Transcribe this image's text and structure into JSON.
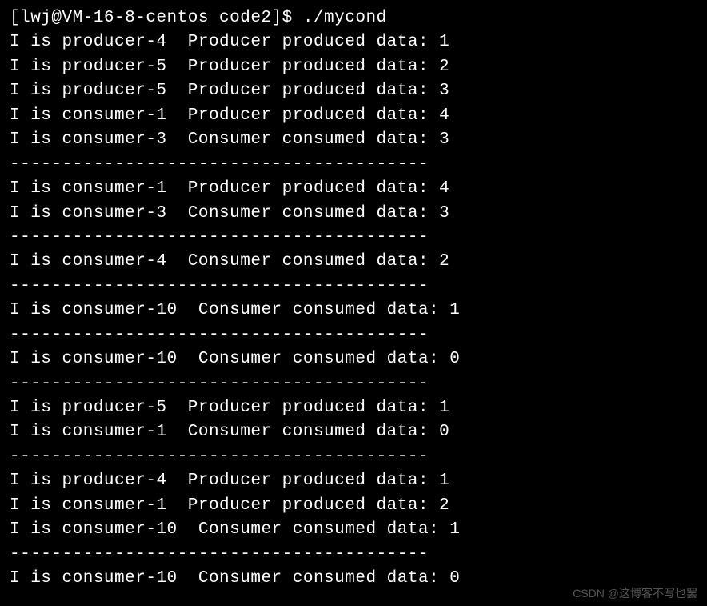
{
  "prompt": "[lwj@VM-16-8-centos code2]$ ./mycond",
  "lines": [
    "I is producer-4  Producer produced data: 1",
    "I is producer-5  Producer produced data: 2",
    "I is producer-5  Producer produced data: 3",
    "I is consumer-1  Producer produced data: 4",
    "I is consumer-3  Consumer consumed data: 3",
    "----------------------------------------",
    "I is consumer-1  Producer produced data: 4",
    "I is consumer-3  Consumer consumed data: 3",
    "----------------------------------------",
    "I is consumer-4  Consumer consumed data: 2",
    "----------------------------------------",
    "I is consumer-10  Consumer consumed data: 1",
    "----------------------------------------",
    "I is consumer-10  Consumer consumed data: 0",
    "----------------------------------------",
    "I is producer-5  Producer produced data: 1",
    "I is consumer-1  Consumer consumed data: 0",
    "----------------------------------------",
    "I is producer-4  Producer produced data: 1",
    "I is consumer-1  Producer produced data: 2",
    "I is consumer-10  Consumer consumed data: 1",
    "----------------------------------------",
    "I is consumer-10  Consumer consumed data: 0"
  ],
  "watermark": "CSDN @这博客不写也罢"
}
